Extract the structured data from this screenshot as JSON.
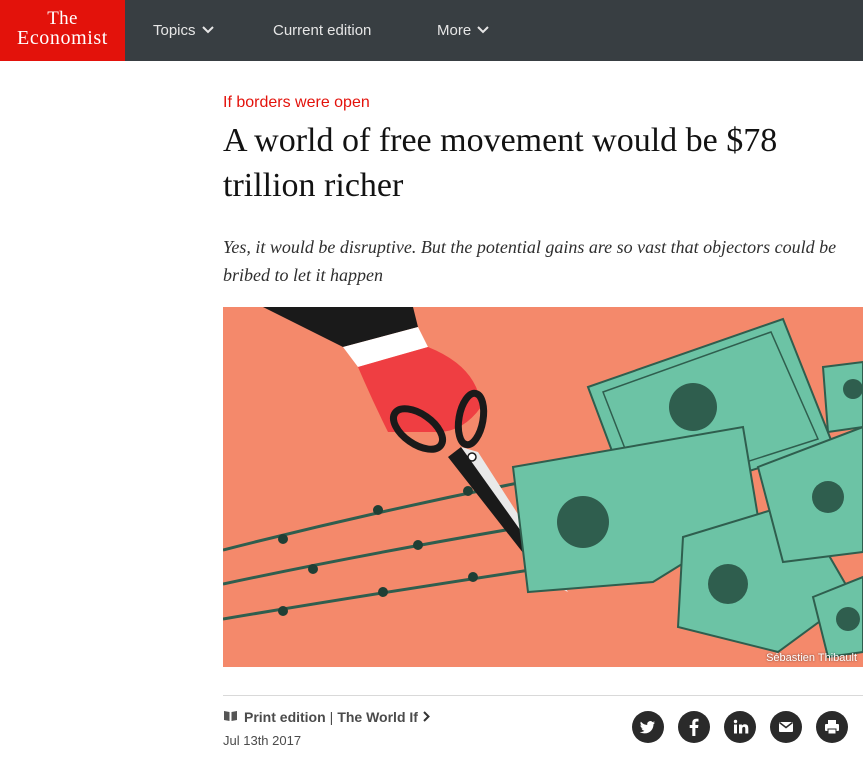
{
  "brand": {
    "logo_line1": "The",
    "logo_line2": "Economist",
    "color": "#e3120b"
  },
  "nav": {
    "topics": "Topics",
    "current_edition": "Current edition",
    "more": "More"
  },
  "article": {
    "flytitle": "If borders were open",
    "headline": "A world of free movement would be $78 trillion richer",
    "rubric": "Yes, it would be disruptive. But the potential gains are so vast that objectors could be bribed to let it happen",
    "image_credit": "Sébastien Thibault",
    "print_edition": "Print edition",
    "section": "The World If",
    "date": "Jul 13th 2017"
  },
  "share": [
    "twitter-icon",
    "facebook-icon",
    "linkedin-icon",
    "email-icon",
    "print-icon"
  ],
  "colors": {
    "nav_bg": "#383e42",
    "accent_red": "#e3120b",
    "image_bg": "#f4896b",
    "money_green": "#6cc3a5"
  }
}
